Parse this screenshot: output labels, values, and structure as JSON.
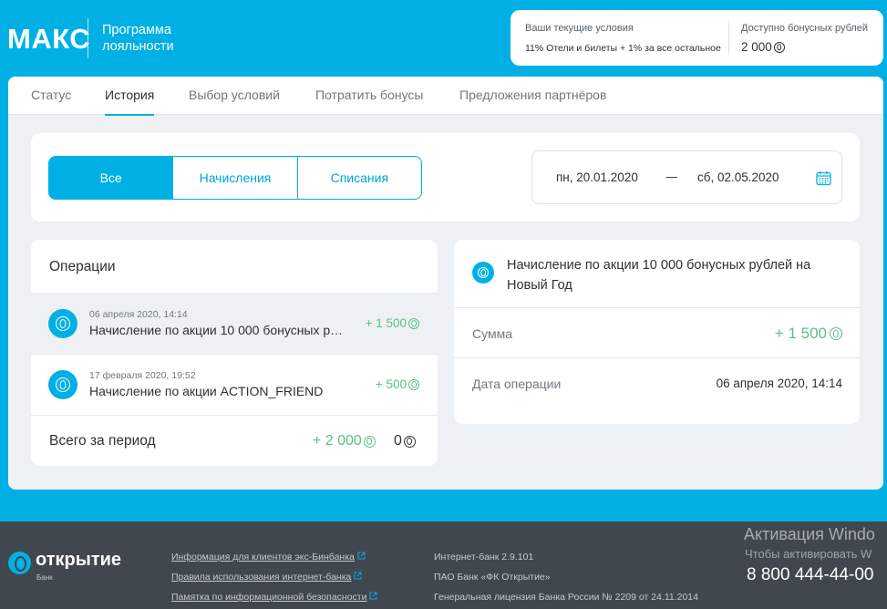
{
  "header": {
    "logo": "МАКС",
    "program_line1": "Программа",
    "program_line2": "лояльности",
    "conditions_label": "Ваши текущие условия",
    "conditions_value": "11% Отели и билеты + 1% за все остальное",
    "bonus_label": "Доступно бонусных рублей",
    "bonus_value": "2 000"
  },
  "tabs": [
    {
      "label": "Статус"
    },
    {
      "label": "История"
    },
    {
      "label": "Выбор условий"
    },
    {
      "label": "Потратить бонусы"
    },
    {
      "label": "Предложения партнёров"
    }
  ],
  "active_tab": "История",
  "filter": {
    "segments": [
      {
        "label": "Все"
      },
      {
        "label": "Начисления"
      },
      {
        "label": "Списания"
      }
    ],
    "active_segment": "Все",
    "date_from": "пн, 20.01.2020",
    "date_sep": "—",
    "date_to": "сб, 02.05.2020"
  },
  "operations": {
    "title": "Операции",
    "items": [
      {
        "date": "06 апреля 2020, 14:14",
        "description": "Начисление по акции 10 000 бонусных рублей на Новый Год",
        "amount": "+ 1 500"
      },
      {
        "date": "17 февраля 2020, 19:52",
        "description": "Начисление по акции ACTION_FRIEND",
        "amount": "+ 500"
      }
    ],
    "total_label": "Всего за период",
    "total_accrued": "+ 2 000",
    "total_spent": "0"
  },
  "detail": {
    "title": "Начисление по акции 10 000 бонусных рублей на Новый Год",
    "sum_label": "Сумма",
    "sum_value": "+ 1 500",
    "date_label": "Дата операции",
    "date_value": "06 апреля 2020, 14:14"
  },
  "footer": {
    "brand": "открытие",
    "brand_sub": "Банк",
    "links": [
      "Информация для клиентов экс-Бинбанка",
      "Правила использования интернет-банка",
      "Памятка по информационной безопасности"
    ],
    "info": [
      "Интернет-банк 2.9.101",
      "ПАО Банк «ФК Открытие»",
      "Генеральная лицензия Банка России № 2209 от 24.11.2014"
    ],
    "phone": "8 800 444-44-00",
    "windows_title": "Активация Windo",
    "windows_sub": "Чтобы активировать W"
  },
  "colors": {
    "accent": "#00b0e4",
    "positive": "#59c184",
    "footer_bg": "#41474f",
    "panel_bg": "#eef1f4"
  },
  "icons": {
    "bonus": "bonus-coin-icon",
    "calendar": "calendar-icon",
    "external": "external-link-icon",
    "brand": "otkritie-logo-icon"
  }
}
